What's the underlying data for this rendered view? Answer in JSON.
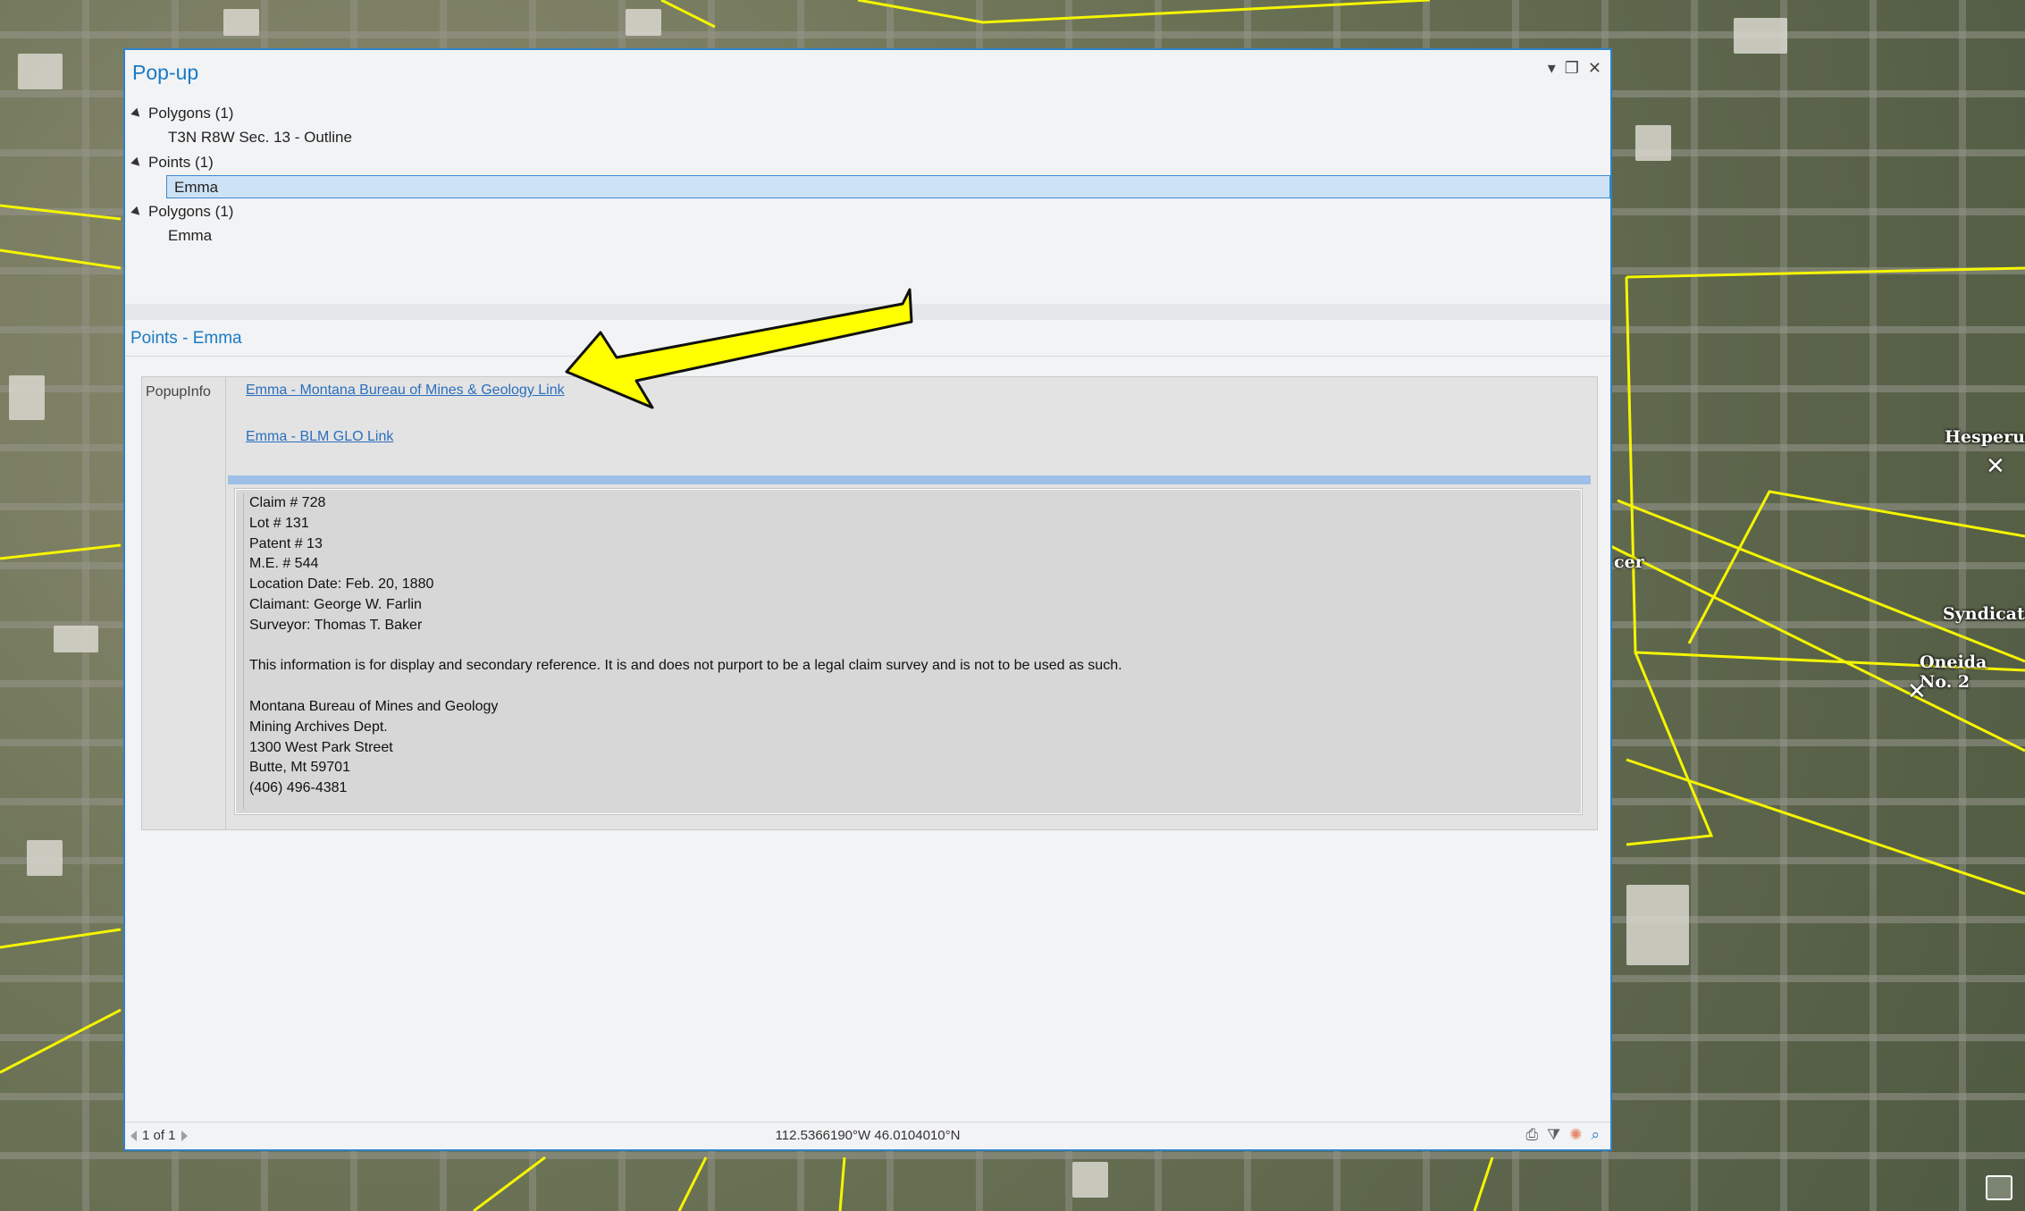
{
  "window": {
    "title": "Pop-up",
    "minimize_icon": "dropdown-icon",
    "maximize_icon": "maximize-icon",
    "close_icon": "close-icon"
  },
  "tree": [
    {
      "label": "Polygons  (1)",
      "child": "T3N R8W Sec. 13 - Outline"
    },
    {
      "label": "Points  (1)",
      "child": "Emma",
      "selected": true
    },
    {
      "label": "Polygons  (1)",
      "child": "Emma"
    }
  ],
  "detail": {
    "section_title": "Points - Emma",
    "field_label": "PopupInfo",
    "link_mbmg": "Emma - Montana Bureau of Mines & Geology Link",
    "link_blm": "Emma - BLM GLO Link",
    "info_lines": [
      "Claim # 728",
      "Lot # 131",
      "Patent # 13",
      "M.E. # 544",
      "Location Date: Feb. 20, 1880",
      "Claimant: George W. Farlin",
      "Surveyor: Thomas T. Baker",
      "",
      "This information is for display and secondary reference. It is and does not purport to be a legal claim survey and is not to be used as such.",
      "",
      "Montana Bureau of Mines and Geology",
      "Mining Archives Dept.",
      "1300 West Park Street",
      "Butte, Mt 59701",
      "(406) 496-4381"
    ]
  },
  "footer": {
    "pager": "1 of 1",
    "coordinates": "112.5366190°W 46.0104010°N",
    "tools": [
      "print-icon",
      "filter-icon",
      "flash-icon",
      "zoom-to-icon"
    ]
  },
  "map": {
    "labels": [
      "Hesperus",
      "cer",
      "Syndicate",
      "Oneida No. 2"
    ],
    "boundary_color": "#f5f500"
  },
  "annotation": {
    "arrow_color": "#ffff00"
  }
}
